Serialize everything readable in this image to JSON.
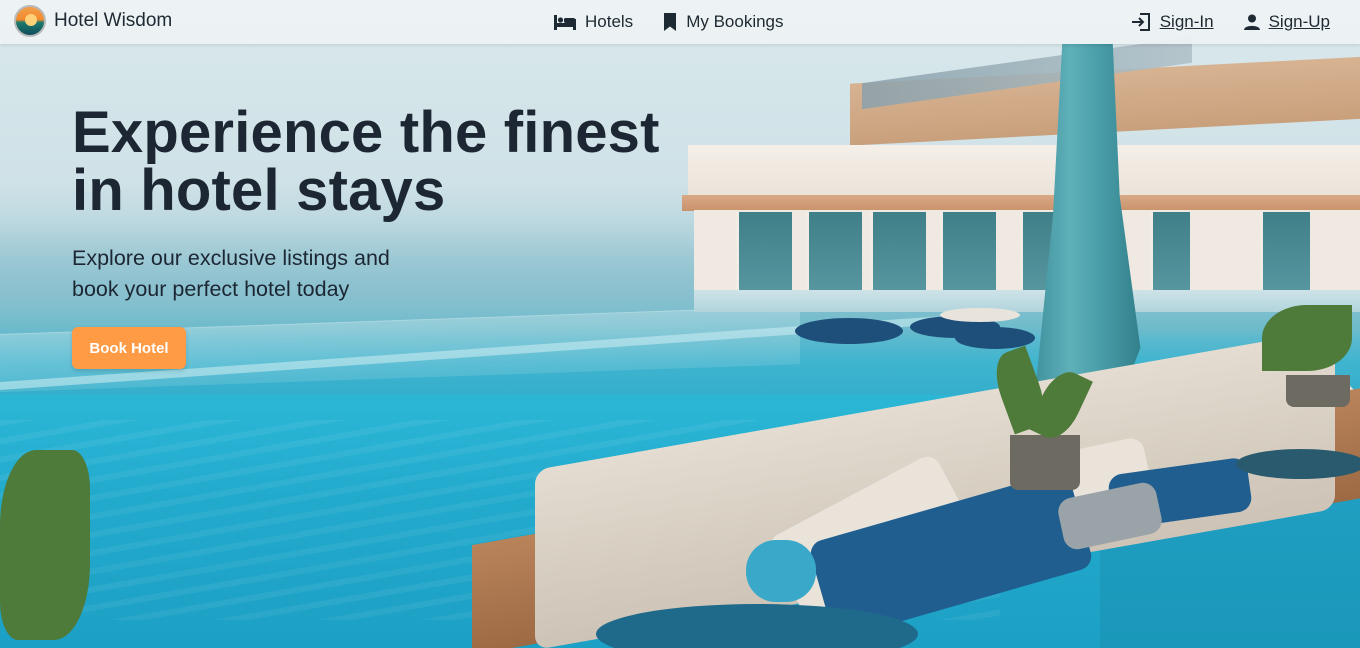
{
  "navbar": {
    "brand": {
      "name": "Hotel Wisdom",
      "logo_icon": "sunset-logo-icon"
    },
    "links": [
      {
        "label": "Hotels",
        "icon": "bed-icon"
      },
      {
        "label": "My Bookings",
        "icon": "bookmark-icon"
      }
    ],
    "auth": [
      {
        "label": "Sign-In",
        "icon": "login-icon"
      },
      {
        "label": "Sign-Up",
        "icon": "user-icon"
      }
    ]
  },
  "hero": {
    "title_line1": "Experience the finest",
    "title_line2": "in hotel stays",
    "subtitle_line1": "Explore our exclusive listings and",
    "subtitle_line2": "book your perfect hotel today",
    "cta_label": "Book Hotel",
    "background_image": "infinity-pool-resort-photo"
  },
  "colors": {
    "accent": "#ff9a45",
    "text": "#1c2733",
    "navbar_bg": "#eef2f4"
  }
}
